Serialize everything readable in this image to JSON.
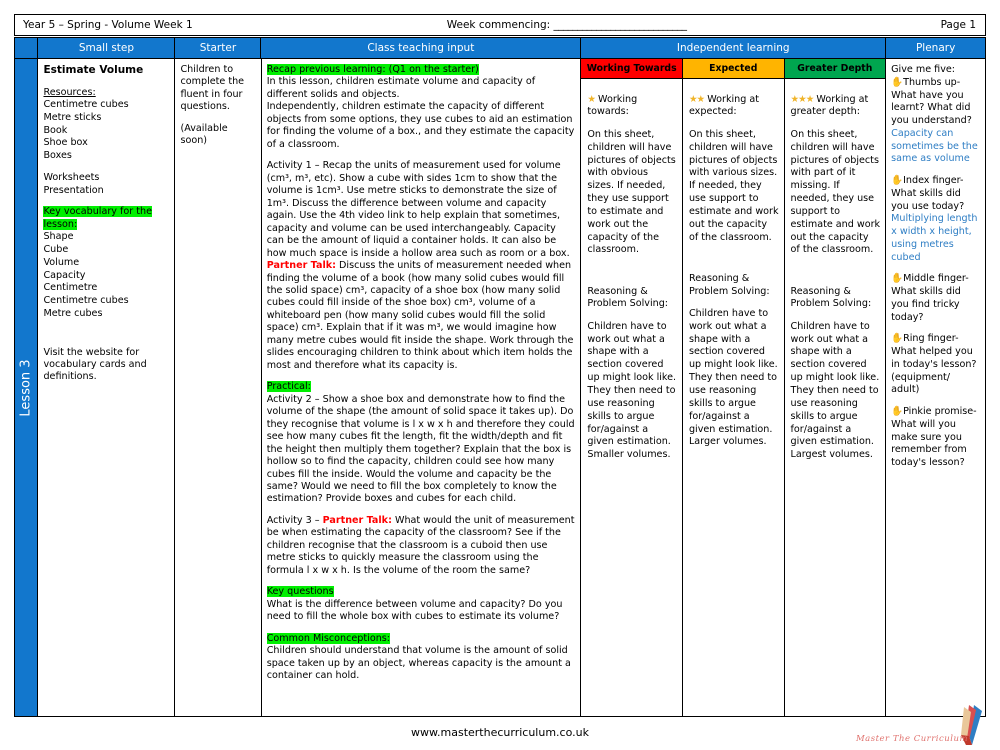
{
  "meta": {
    "left": "Year 5 – Spring - Volume Week 1",
    "middle_label": "Week commencing:",
    "middle_rule": "____________________________",
    "right": "Page 1"
  },
  "lesson_tab": "Lesson 3",
  "headers": {
    "small_step": "Small step",
    "starter": "Starter",
    "class_teaching_input": "Class teaching input",
    "independent_learning": "Independent learning",
    "plenary": "Plenary"
  },
  "colors": {
    "header_blue": "#1277cd",
    "highlight_green": "#00ef00",
    "working_towards": "#ff0000",
    "expected": "#ffb400",
    "greater_depth": "#00a64f",
    "partner_talk_red": "#ff0000",
    "plenary_answer_blue": "#2f7ec4"
  },
  "small_step": {
    "title": "Estimate Volume",
    "resources_label": "Resources:",
    "resources": [
      "Centimetre cubes",
      "Metre sticks",
      "Book",
      "Shoe box",
      "Boxes"
    ],
    "materials": [
      "Worksheets",
      "Presentation"
    ],
    "vocab_label": "Key vocabulary for the lesson:",
    "vocabulary": [
      "Shape",
      "Cube",
      "Volume",
      "Capacity",
      "Centimetre",
      "Centimetre cubes",
      "Metre cubes"
    ],
    "footnote": "Visit the website for vocabulary cards and definitions."
  },
  "starter": {
    "line1": "Children to complete the fluent in four questions.",
    "line2": "(Available soon)"
  },
  "teaching_input": {
    "recap_label": "Recap previous learning: (Q1 on the starter)",
    "recap_body_1": "In this lesson, children estimate volume and capacity of different solids and objects.",
    "recap_body_2": "Independently, children estimate the capacity of different objects from some options, they use cubes to aid an estimation for finding the volume of a box., and they estimate the capacity of a classroom.",
    "activity1": "Activity 1 – Recap the units of measurement used for volume (cm³, m³, etc).  Show a cube with sides 1cm to show that the volume is 1cm³. Use metre sticks to demonstrate the size of 1m³. Discuss the difference between volume and capacity again. Use the 4th video link to help explain that sometimes, capacity and volume can be used interchangeably. Capacity can be the amount of liquid a container holds. It can also be how much space is inside a hollow area such as room or a box.",
    "partner_talk_label": "Partner Talk:",
    "partner_talk_body": "Discuss the units of measurement needed when finding the volume of a book (how many solid cubes would fill the solid space) cm³, capacity of a shoe box (how many solid cubes could fill inside of the shoe box) cm³, volume of a whiteboard pen (how many solid cubes would fill the solid space) cm³. Explain that if it was m³, we would imagine how many metre cubes would fit inside the shape. Work through the slides encouraging children to think about which item holds the most and therefore what its capacity is.",
    "practical_label": "Practical:",
    "activity2": "Activity 2 – Show a shoe box and demonstrate how to find the volume of the shape (the amount of solid space it takes up). Do they recognise that volume is l x w x h and therefore they could see how many cubes fit the length, fit the width/depth and fit the height then multiply them together? Explain that the box is hollow so to find the capacity, children could see how many cubes fill the inside. Would the volume and capacity be the same? Would we need to fill the box completely to know the estimation? Provide boxes and cubes for each child.",
    "activity3_prefix": "Activity 3 – ",
    "activity3_label": "Partner Talk:",
    "activity3_body": "What would the unit of measurement be when estimating the capacity of the classroom? See if the children recognise that the classroom is a cuboid then use metre sticks to quickly measure the classroom using the formula l x w x h. Is the volume of the room the same?",
    "key_questions_label": "Key questions",
    "key_questions_body": "What is the difference between volume and capacity? Do you need to fill the whole box with cubes to estimate its volume?",
    "misconceptions_label": "Common Misconceptions:",
    "misconceptions_body": "Children should understand that volume is the amount of solid space taken up by an object,  whereas capacity is the amount a container can hold."
  },
  "independent_learning": [
    {
      "header": "Working Towards",
      "stars": "★",
      "intro_label": "Working towards:",
      "body": "On this sheet, children will have pictures of objects with obvious sizes. If needed, they use support to estimate and work out the capacity of the classroom.",
      "reasoning_label": "Reasoning & Problem Solving:",
      "reasoning_body": "Children have to work out what a shape with a section covered up might look like. They then need to use reasoning skills to argue for/against a given estimation. Smaller volumes."
    },
    {
      "header": "Expected",
      "stars": "★★",
      "intro_label": "Working at expected:",
      "body": " On this sheet, children will have pictures of objects with various sizes. If needed, they use support to estimate and work out the capacity of the classroom.",
      "reasoning_label": "Reasoning & Problem Solving:",
      "reasoning_body": "Children have to work out what a shape with a section covered up might look like. They then need to use reasoning skills to argue for/against a given estimation. Larger volumes."
    },
    {
      "header": "Greater Depth",
      "stars": "★★★",
      "intro_label": "Working at greater depth:",
      "body": "On this sheet, children will have pictures of objects with part of it missing. If needed, they use support to estimate and work out the capacity of the classroom.",
      "reasoning_label": "Reasoning & Problem Solving:",
      "reasoning_body": "Children have to work out what a shape with a section covered up might look like. They then need to use reasoning skills to argue for/against a given estimation. Largest volumes."
    }
  ],
  "plenary": {
    "title": "Give me five:",
    "items": [
      {
        "hand": "✋",
        "prompt": "Thumbs up- What have you learnt? What did you understand?",
        "answer": "Capacity can sometimes be the same as volume"
      },
      {
        "hand": "✋",
        "prompt": "Index finger- What skills did you use today?",
        "answer": "Multiplying length x width x height, using metres cubed"
      },
      {
        "hand": "✋",
        "prompt": "Middle finger- What skills did you find tricky today?",
        "answer": ""
      },
      {
        "hand": "✋",
        "prompt": "Ring finger- What helped you in today's lesson? (equipment/ adult)",
        "answer": ""
      },
      {
        "hand": "✋",
        "prompt": "Pinkie promise- What will you make sure you remember from today's lesson?",
        "answer": ""
      }
    ]
  },
  "footer": {
    "url": "www.masterthecurriculum.co.uk",
    "logo_text": "Master The Curriculum"
  }
}
